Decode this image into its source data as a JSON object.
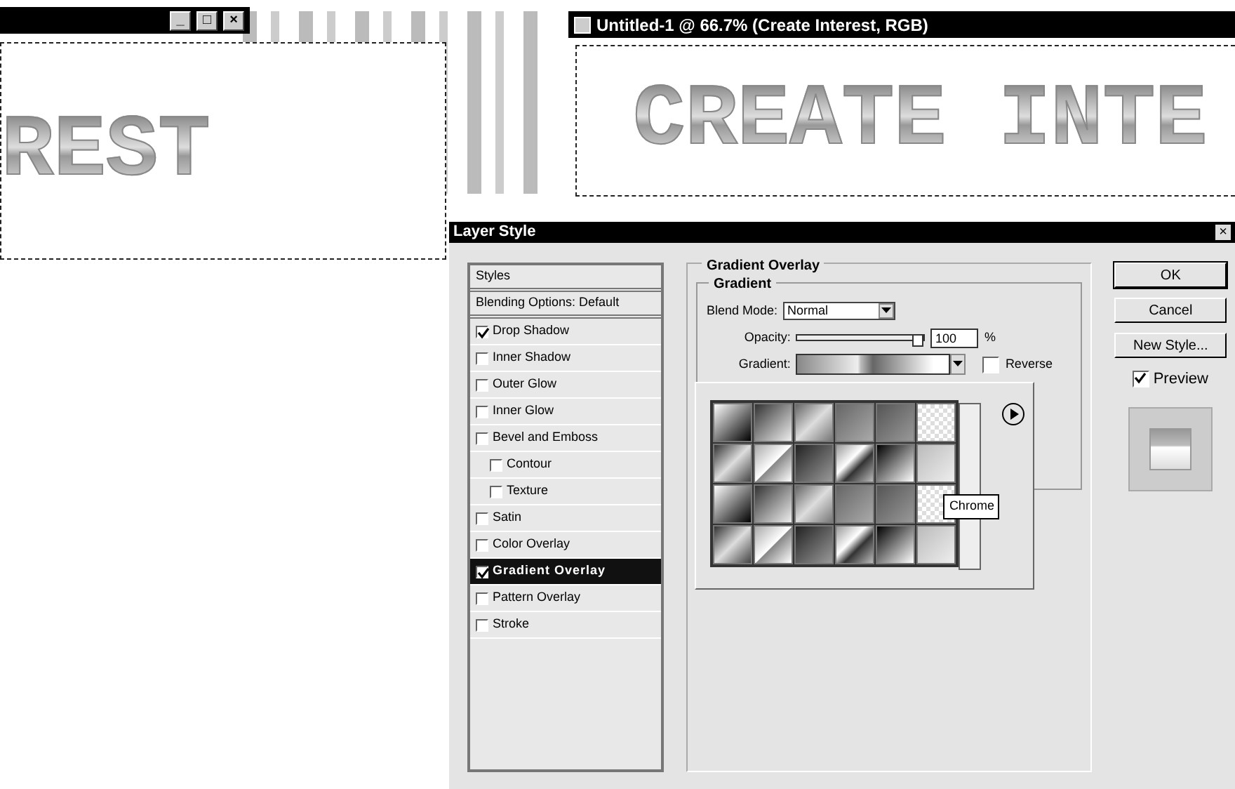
{
  "documents": [
    {
      "canvas_text": "REST",
      "window_buttons": [
        "_",
        "□",
        "×"
      ]
    },
    {
      "title": "Untitled-1 @ 66.7% (Create Interest, RGB)",
      "canvas_text": "CREATE INTE"
    }
  ],
  "dialog": {
    "title": "Layer Style",
    "close": "×",
    "styles_header": "Styles",
    "styles": [
      {
        "label": "Blending Options: Default",
        "kind": "plain",
        "selected": false
      },
      {
        "label": "Drop Shadow",
        "kind": "check",
        "checked": true,
        "selected": false
      },
      {
        "label": "Inner Shadow",
        "kind": "check",
        "checked": false,
        "selected": false
      },
      {
        "label": "Outer Glow",
        "kind": "check",
        "checked": false,
        "selected": false
      },
      {
        "label": "Inner Glow",
        "kind": "check",
        "checked": false,
        "selected": false
      },
      {
        "label": "Bevel and Emboss",
        "kind": "check",
        "checked": false,
        "selected": false,
        "children": [
          {
            "label": "Contour",
            "kind": "check",
            "checked": false,
            "selected": false
          },
          {
            "label": "Texture",
            "kind": "check",
            "checked": false,
            "selected": false
          }
        ]
      },
      {
        "label": "Satin",
        "kind": "check",
        "checked": false,
        "selected": false
      },
      {
        "label": "Color Overlay",
        "kind": "check",
        "checked": false,
        "selected": false
      },
      {
        "label": "Gradient Overlay",
        "kind": "check",
        "checked": true,
        "selected": true
      },
      {
        "label": "Pattern Overlay",
        "kind": "check",
        "checked": false,
        "selected": false
      },
      {
        "label": "Stroke",
        "kind": "check",
        "checked": false,
        "selected": false
      }
    ],
    "section": {
      "title": "Gradient Overlay",
      "group": "Gradient",
      "blend_mode_label": "Blend Mode:",
      "blend_mode": "Normal",
      "opacity_label": "Opacity:",
      "opacity": {
        "level": 1,
        "value": "100",
        "unit": "%"
      },
      "gradient_label": "Gradient:",
      "reverse": {
        "label": "Reverse",
        "checked": false
      },
      "tooltip": "Chrome"
    },
    "buttons": [
      "OK",
      "Cancel",
      "New Style..."
    ],
    "preview": {
      "label": "Preview",
      "checked": true
    }
  }
}
